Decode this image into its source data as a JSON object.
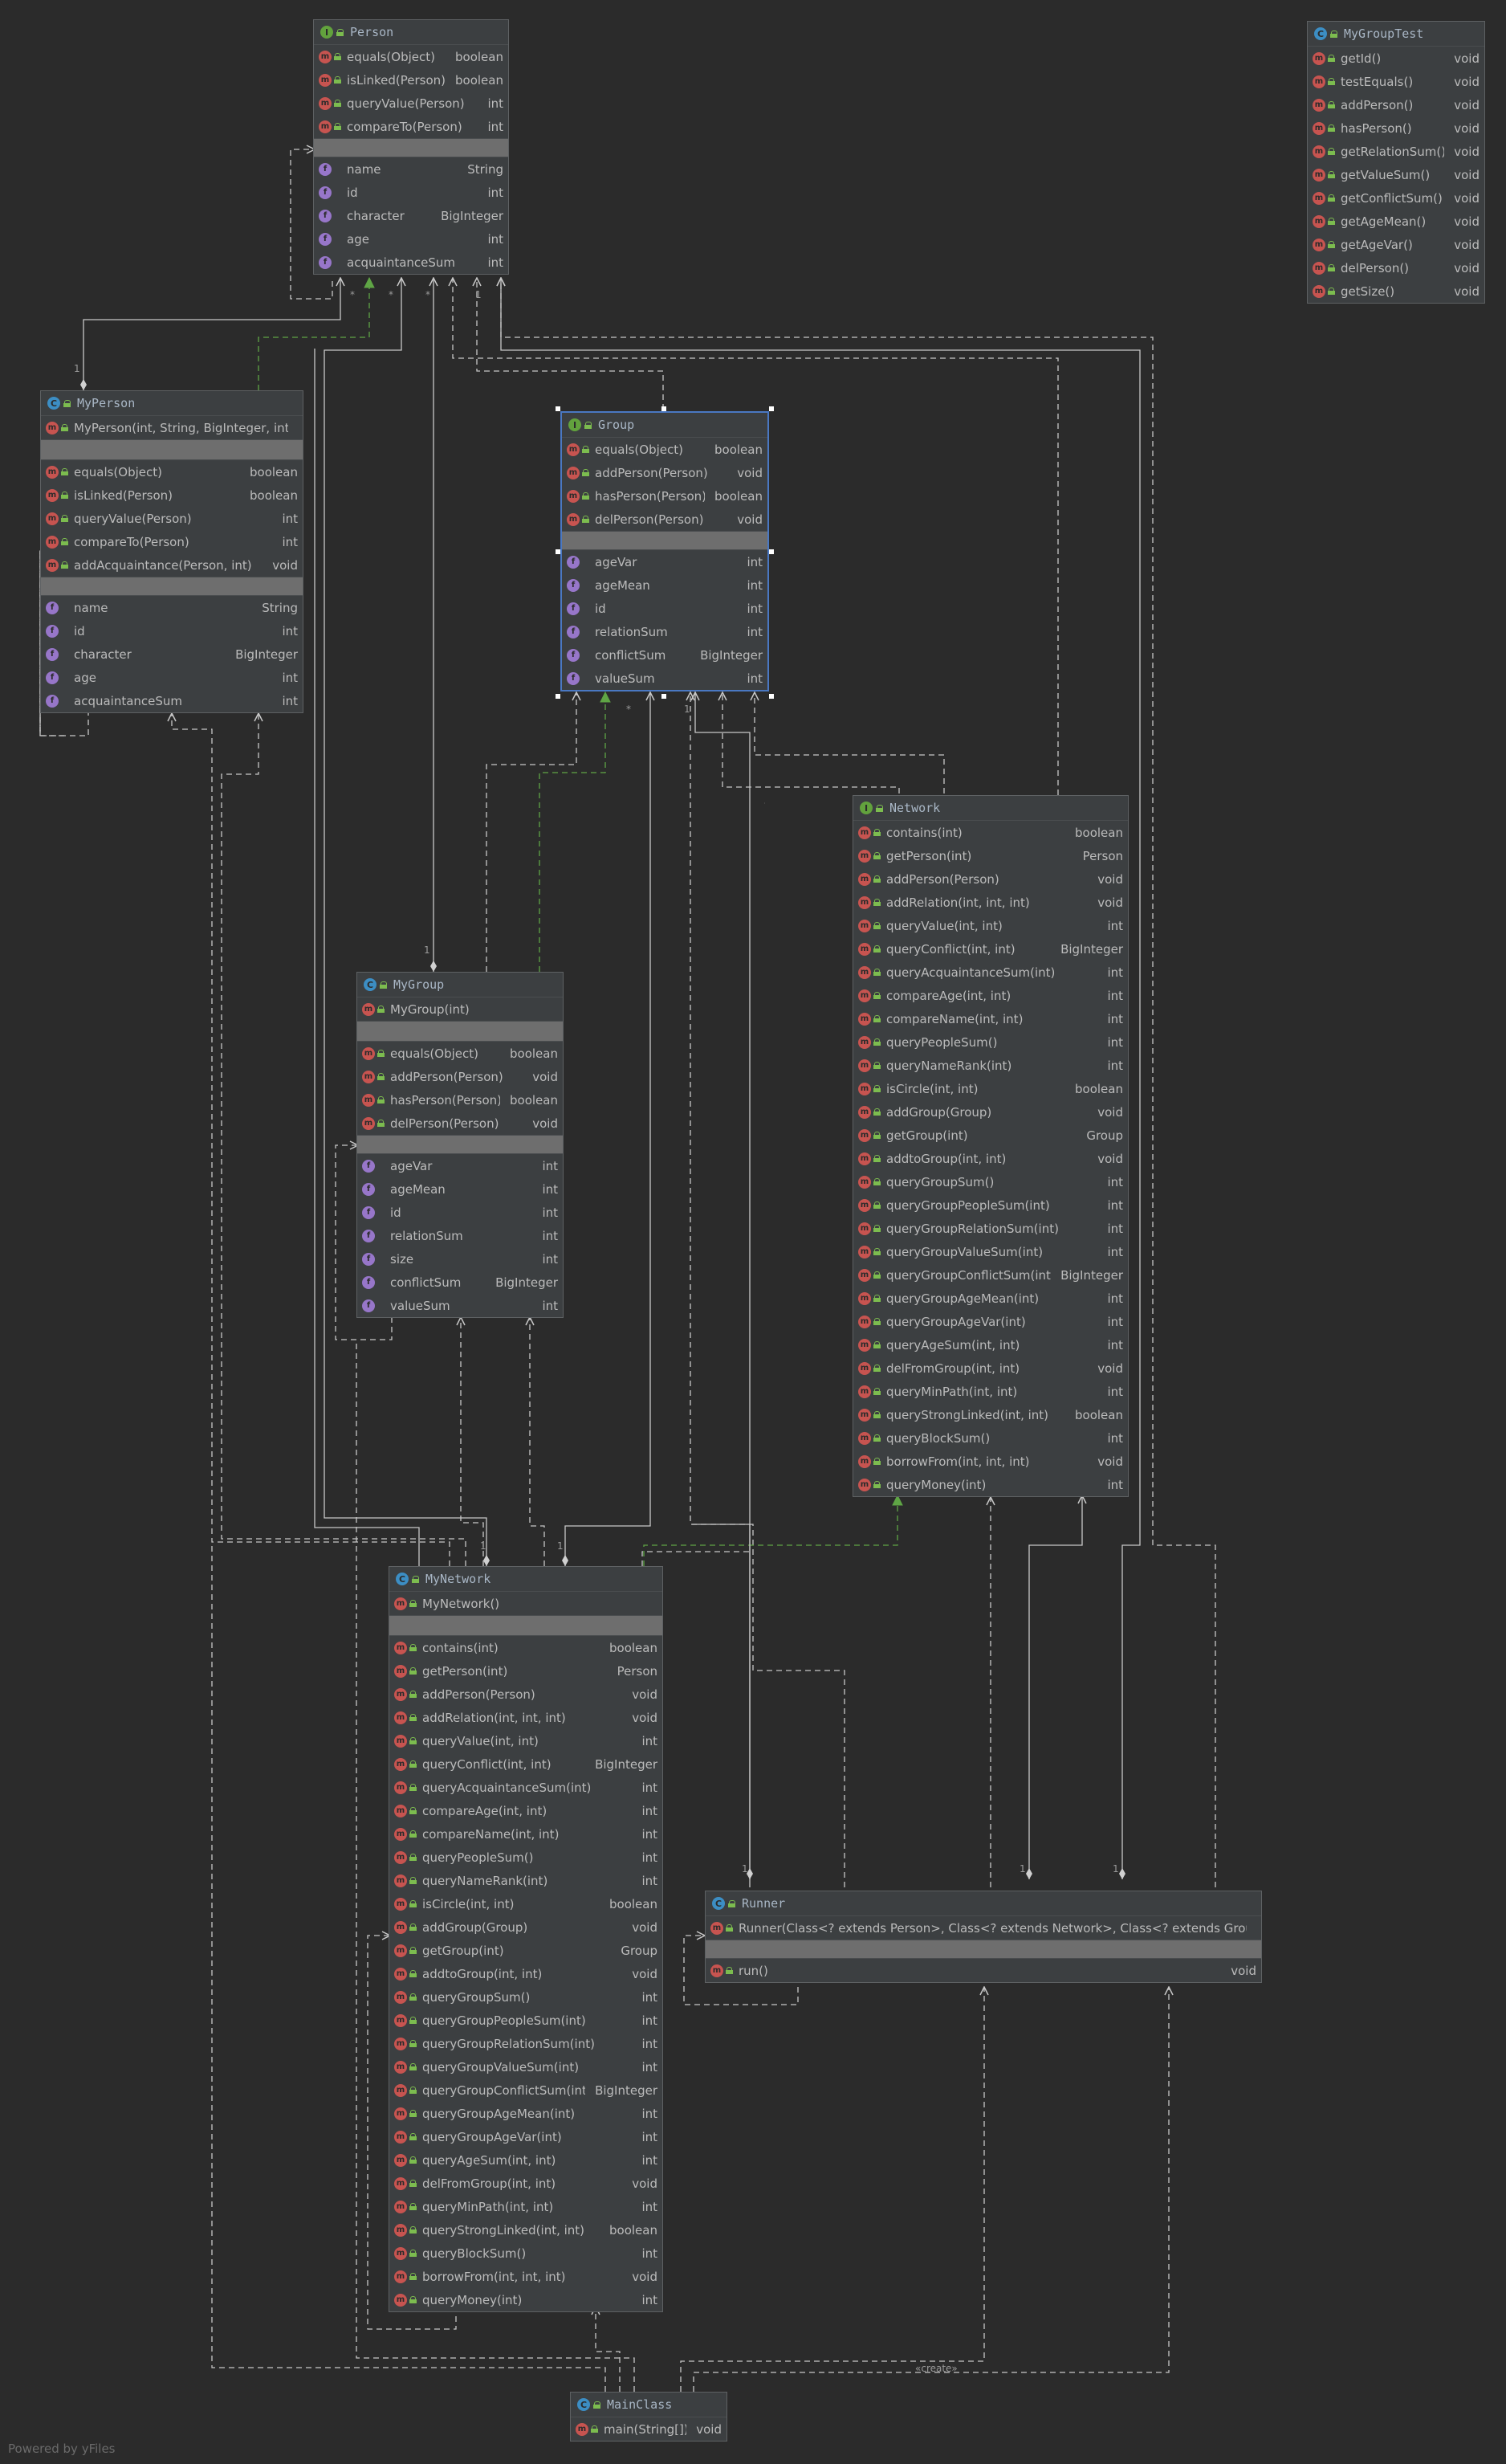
{
  "footer": "Powered by yFiles",
  "create_label": "«create»",
  "multiplicity": {
    "one": "1",
    "many": "*"
  },
  "nodes": {
    "person": {
      "name": "Person",
      "kind": "interface",
      "methods": [
        {
          "name": "equals(Object)",
          "type": "boolean"
        },
        {
          "name": "isLinked(Person)",
          "type": "boolean"
        },
        {
          "name": "queryValue(Person)",
          "type": "int"
        },
        {
          "name": "compareTo(Person)",
          "type": "int"
        }
      ],
      "fields": [
        {
          "name": "name",
          "type": "String"
        },
        {
          "name": "id",
          "type": "int"
        },
        {
          "name": "character",
          "type": "BigInteger"
        },
        {
          "name": "age",
          "type": "int"
        },
        {
          "name": "acquaintanceSum",
          "type": "int"
        }
      ]
    },
    "mygrouptest": {
      "name": "MyGroupTest",
      "kind": "class",
      "methods": [
        {
          "name": "getId()",
          "type": "void"
        },
        {
          "name": "testEquals()",
          "type": "void"
        },
        {
          "name": "addPerson()",
          "type": "void"
        },
        {
          "name": "hasPerson()",
          "type": "void"
        },
        {
          "name": "getRelationSum()",
          "type": "void"
        },
        {
          "name": "getValueSum()",
          "type": "void"
        },
        {
          "name": "getConflictSum()",
          "type": "void"
        },
        {
          "name": "getAgeMean()",
          "type": "void"
        },
        {
          "name": "getAgeVar()",
          "type": "void"
        },
        {
          "name": "delPerson()",
          "type": "void"
        },
        {
          "name": "getSize()",
          "type": "void"
        }
      ]
    },
    "myperson": {
      "name": "MyPerson",
      "kind": "class",
      "constructors": [
        {
          "name": "MyPerson(int, String, BigInteger, int)",
          "type": ""
        }
      ],
      "methods": [
        {
          "name": "equals(Object)",
          "type": "boolean"
        },
        {
          "name": "isLinked(Person)",
          "type": "boolean"
        },
        {
          "name": "queryValue(Person)",
          "type": "int"
        },
        {
          "name": "compareTo(Person)",
          "type": "int"
        },
        {
          "name": "addAcquaintance(Person, int)",
          "type": "void"
        }
      ],
      "fields": [
        {
          "name": "name",
          "type": "String"
        },
        {
          "name": "id",
          "type": "int"
        },
        {
          "name": "character",
          "type": "BigInteger"
        },
        {
          "name": "age",
          "type": "int"
        },
        {
          "name": "acquaintanceSum",
          "type": "int"
        }
      ]
    },
    "group": {
      "name": "Group",
      "kind": "interface",
      "methods": [
        {
          "name": "equals(Object)",
          "type": "boolean"
        },
        {
          "name": "addPerson(Person)",
          "type": "void"
        },
        {
          "name": "hasPerson(Person)",
          "type": "boolean"
        },
        {
          "name": "delPerson(Person)",
          "type": "void"
        }
      ],
      "fields": [
        {
          "name": "ageVar",
          "type": "int"
        },
        {
          "name": "ageMean",
          "type": "int"
        },
        {
          "name": "id",
          "type": "int"
        },
        {
          "name": "relationSum",
          "type": "int"
        },
        {
          "name": "conflictSum",
          "type": "BigInteger"
        },
        {
          "name": "valueSum",
          "type": "int"
        }
      ]
    },
    "network": {
      "name": "Network",
      "kind": "interface",
      "methods": [
        {
          "name": "contains(int)",
          "type": "boolean"
        },
        {
          "name": "getPerson(int)",
          "type": "Person"
        },
        {
          "name": "addPerson(Person)",
          "type": "void"
        },
        {
          "name": "addRelation(int, int, int)",
          "type": "void"
        },
        {
          "name": "queryValue(int, int)",
          "type": "int"
        },
        {
          "name": "queryConflict(int, int)",
          "type": "BigInteger"
        },
        {
          "name": "queryAcquaintanceSum(int)",
          "type": "int"
        },
        {
          "name": "compareAge(int, int)",
          "type": "int"
        },
        {
          "name": "compareName(int, int)",
          "type": "int"
        },
        {
          "name": "queryPeopleSum()",
          "type": "int"
        },
        {
          "name": "queryNameRank(int)",
          "type": "int"
        },
        {
          "name": "isCircle(int, int)",
          "type": "boolean"
        },
        {
          "name": "addGroup(Group)",
          "type": "void"
        },
        {
          "name": "getGroup(int)",
          "type": "Group"
        },
        {
          "name": "addtoGroup(int, int)",
          "type": "void"
        },
        {
          "name": "queryGroupSum()",
          "type": "int"
        },
        {
          "name": "queryGroupPeopleSum(int)",
          "type": "int"
        },
        {
          "name": "queryGroupRelationSum(int)",
          "type": "int"
        },
        {
          "name": "queryGroupValueSum(int)",
          "type": "int"
        },
        {
          "name": "queryGroupConflictSum(int)",
          "type": "BigInteger"
        },
        {
          "name": "queryGroupAgeMean(int)",
          "type": "int"
        },
        {
          "name": "queryGroupAgeVar(int)",
          "type": "int"
        },
        {
          "name": "queryAgeSum(int, int)",
          "type": "int"
        },
        {
          "name": "delFromGroup(int, int)",
          "type": "void"
        },
        {
          "name": "queryMinPath(int, int)",
          "type": "int"
        },
        {
          "name": "queryStrongLinked(int, int)",
          "type": "boolean"
        },
        {
          "name": "queryBlockSum()",
          "type": "int"
        },
        {
          "name": "borrowFrom(int, int, int)",
          "type": "void"
        },
        {
          "name": "queryMoney(int)",
          "type": "int"
        }
      ]
    },
    "mygroup": {
      "name": "MyGroup",
      "kind": "class",
      "constructors": [
        {
          "name": "MyGroup(int)",
          "type": ""
        }
      ],
      "methods": [
        {
          "name": "equals(Object)",
          "type": "boolean"
        },
        {
          "name": "addPerson(Person)",
          "type": "void"
        },
        {
          "name": "hasPerson(Person)",
          "type": "boolean"
        },
        {
          "name": "delPerson(Person)",
          "type": "void"
        }
      ],
      "fields": [
        {
          "name": "ageVar",
          "type": "int"
        },
        {
          "name": "ageMean",
          "type": "int"
        },
        {
          "name": "id",
          "type": "int"
        },
        {
          "name": "relationSum",
          "type": "int"
        },
        {
          "name": "size",
          "type": "int"
        },
        {
          "name": "conflictSum",
          "type": "BigInteger"
        },
        {
          "name": "valueSum",
          "type": "int"
        }
      ]
    },
    "mynetwork": {
      "name": "MyNetwork",
      "kind": "class",
      "constructors": [
        {
          "name": "MyNetwork()",
          "type": ""
        }
      ],
      "methods": [
        {
          "name": "contains(int)",
          "type": "boolean"
        },
        {
          "name": "getPerson(int)",
          "type": "Person"
        },
        {
          "name": "addPerson(Person)",
          "type": "void"
        },
        {
          "name": "addRelation(int, int, int)",
          "type": "void"
        },
        {
          "name": "queryValue(int, int)",
          "type": "int"
        },
        {
          "name": "queryConflict(int, int)",
          "type": "BigInteger"
        },
        {
          "name": "queryAcquaintanceSum(int)",
          "type": "int"
        },
        {
          "name": "compareAge(int, int)",
          "type": "int"
        },
        {
          "name": "compareName(int, int)",
          "type": "int"
        },
        {
          "name": "queryPeopleSum()",
          "type": "int"
        },
        {
          "name": "queryNameRank(int)",
          "type": "int"
        },
        {
          "name": "isCircle(int, int)",
          "type": "boolean"
        },
        {
          "name": "addGroup(Group)",
          "type": "void"
        },
        {
          "name": "getGroup(int)",
          "type": "Group"
        },
        {
          "name": "addtoGroup(int, int)",
          "type": "void"
        },
        {
          "name": "queryGroupSum()",
          "type": "int"
        },
        {
          "name": "queryGroupPeopleSum(int)",
          "type": "int"
        },
        {
          "name": "queryGroupRelationSum(int)",
          "type": "int"
        },
        {
          "name": "queryGroupValueSum(int)",
          "type": "int"
        },
        {
          "name": "queryGroupConflictSum(int)",
          "type": "BigInteger"
        },
        {
          "name": "queryGroupAgeMean(int)",
          "type": "int"
        },
        {
          "name": "queryGroupAgeVar(int)",
          "type": "int"
        },
        {
          "name": "queryAgeSum(int, int)",
          "type": "int"
        },
        {
          "name": "delFromGroup(int, int)",
          "type": "void"
        },
        {
          "name": "queryMinPath(int, int)",
          "type": "int"
        },
        {
          "name": "queryStrongLinked(int, int)",
          "type": "boolean"
        },
        {
          "name": "queryBlockSum()",
          "type": "int"
        },
        {
          "name": "borrowFrom(int, int, int)",
          "type": "void"
        },
        {
          "name": "queryMoney(int)",
          "type": "int"
        }
      ]
    },
    "runner": {
      "name": "Runner",
      "kind": "class",
      "constructors": [
        {
          "name": "Runner(Class<? extends Person>, Class<? extends Network>, Class<? extends Group>)",
          "type": ""
        }
      ],
      "methods": [
        {
          "name": "run()",
          "type": "void"
        }
      ]
    },
    "mainclass": {
      "name": "MainClass",
      "kind": "class",
      "methods": [
        {
          "name": "main(String[])",
          "type": "void"
        }
      ]
    }
  }
}
